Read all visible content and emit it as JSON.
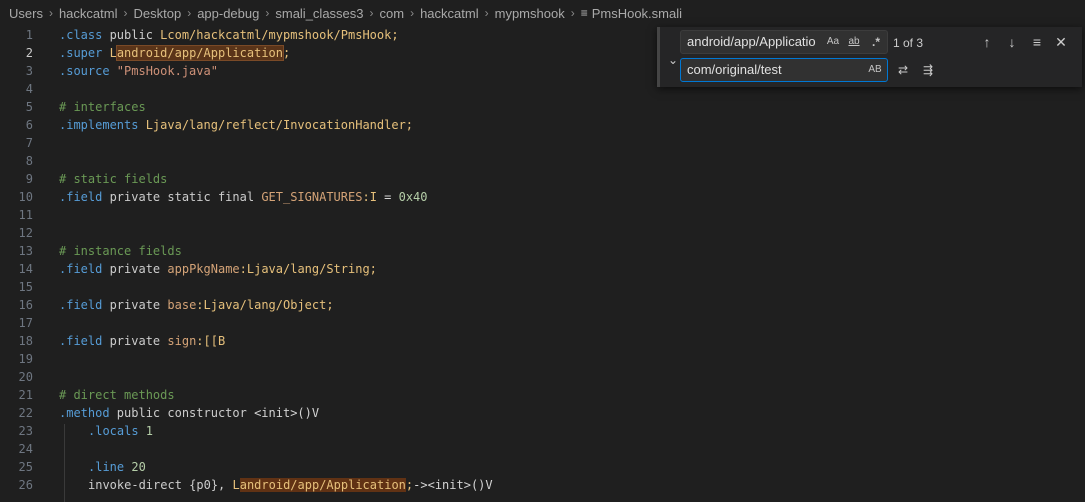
{
  "breadcrumb": {
    "items": [
      "Users",
      "hackcatml",
      "Desktop",
      "app-debug",
      "smali_classes3",
      "com",
      "hackcatml",
      "mypmshook"
    ],
    "file": "PmsHook.smali",
    "file_icon": "lines-icon"
  },
  "editor": {
    "active_line": 2,
    "lines": [
      {
        "n": "1"
      },
      {
        "n": "2"
      },
      {
        "n": "3"
      },
      {
        "n": "4"
      },
      {
        "n": "5"
      },
      {
        "n": "6"
      },
      {
        "n": "7"
      },
      {
        "n": "8"
      },
      {
        "n": "9"
      },
      {
        "n": "10"
      },
      {
        "n": "11"
      },
      {
        "n": "12"
      },
      {
        "n": "13"
      },
      {
        "n": "14"
      },
      {
        "n": "15"
      },
      {
        "n": "16"
      },
      {
        "n": "17"
      },
      {
        "n": "18"
      },
      {
        "n": "19"
      },
      {
        "n": "20"
      },
      {
        "n": "21"
      },
      {
        "n": "22"
      },
      {
        "n": "23"
      },
      {
        "n": "24"
      },
      {
        "n": "25"
      },
      {
        "n": "26"
      }
    ],
    "tokens": {
      "l1_dir": ".class",
      "l1_kw": " public ",
      "l1_type": "Lcom/hackcatml/mypmshook/PmsHook;",
      "l2_dir": ".super",
      "l2_sp": " ",
      "l2_L": "L",
      "l2_type": "android/app/Application",
      "l2_end": ";",
      "l3_dir": ".source",
      "l3_str": " \"PmsHook.java\"",
      "l5_cmt": "# interfaces",
      "l6_dir": ".implements",
      "l6_type": " Ljava/lang/reflect/InvocationHandler;",
      "l9_cmt": "# static fields",
      "l10_dir": ".field",
      "l10_kw": " private static final ",
      "l10_ident": "GET_SIGNATURES",
      "l10_type": ":I",
      "l10_op": " = ",
      "l10_num": "0x40",
      "l13_cmt": "# instance fields",
      "l14_dir": ".field",
      "l14_kw": " private ",
      "l14_ident": "appPkgName",
      "l14_type": ":Ljava/lang/String;",
      "l16_dir": ".field",
      "l16_kw": " private ",
      "l16_ident": "base",
      "l16_type": ":Ljava/lang/Object;",
      "l18_dir": ".field",
      "l18_kw": " private ",
      "l18_ident": "sign",
      "l18_type": ":[[B",
      "l21_cmt": "# direct methods",
      "l22_dir": ".method",
      "l22_kw": " public constructor ",
      "l22_rest": "<init>()V",
      "l23_dir": ".locals",
      "l23_num": " 1",
      "l25_dir": ".line",
      "l25_num": " 20",
      "l26_kw": "invoke-direct {p0}, ",
      "l26_L": "L",
      "l26_type": "android/app/Application",
      "l26_end": ";",
      "l26_rest": "-><init>()V"
    }
  },
  "find_widget": {
    "find_value": "android/app/Applicatio",
    "replace_value": "com/original/test",
    "match_case_label": "Aa",
    "whole_word_label": "ab",
    "regex_label": ".*",
    "preserve_case_label": "AB",
    "result_count": "1 of 3",
    "icons": {
      "toggle": "chevron-down-icon",
      "prev": "arrow-up-icon",
      "next": "arrow-down-icon",
      "selection": "find-in-selection-icon",
      "close": "close-icon",
      "replace": "replace-icon",
      "replace_all": "replace-all-icon"
    }
  },
  "colors": {
    "background": "#1f1f1f",
    "directive": "#569cd6",
    "type": "#e6c07b",
    "comment": "#6a9955",
    "match_highlight": "#613214",
    "focus_border": "#0078d4"
  }
}
